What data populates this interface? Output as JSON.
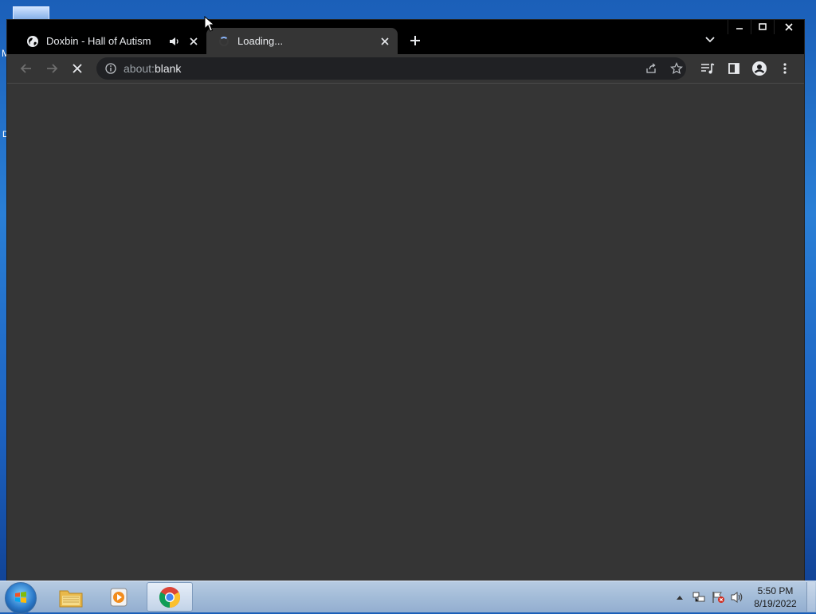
{
  "desktop": {
    "partial_letters": [
      "M",
      "D"
    ]
  },
  "browser": {
    "tabs": [
      {
        "title": "Doxbin - Hall of Autism",
        "favicon": "globe-icon",
        "audio": "speaker-icon",
        "active": false
      },
      {
        "title": "Loading...",
        "favicon": "spinner-icon",
        "active": true
      }
    ],
    "omnibox": {
      "scheme": "about:",
      "path": "blank"
    }
  },
  "taskbar": {
    "apps": [
      "windows-explorer",
      "media-player",
      "chrome"
    ],
    "clock": {
      "time": "5:50 PM",
      "date": "8/19/2022"
    }
  },
  "colors": {
    "tab_strip": "#000000",
    "toolbar": "#353535",
    "omnibox": "#202124",
    "content": "#353535",
    "taskbar": "#a3bcd8"
  }
}
